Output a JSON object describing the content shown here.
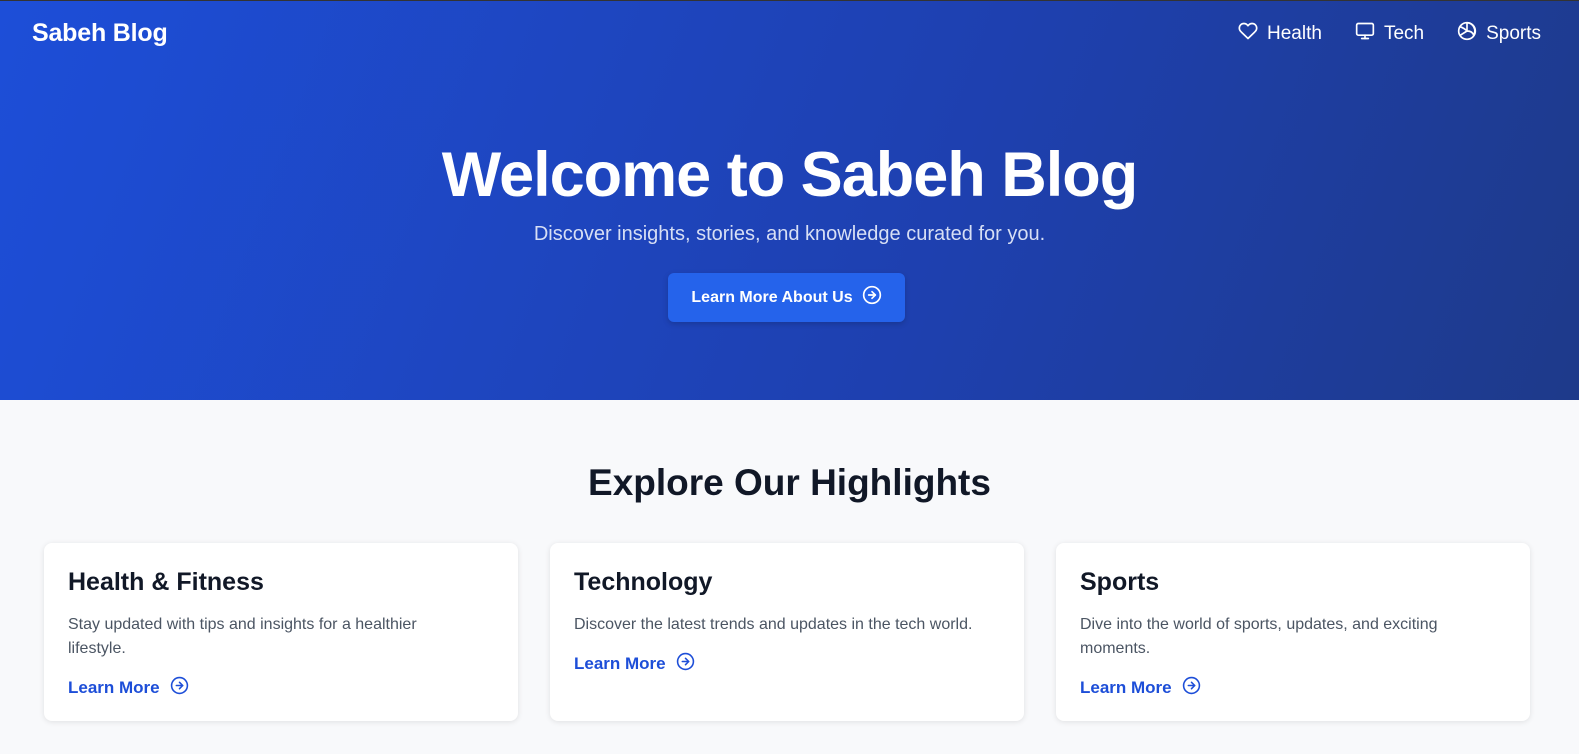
{
  "header": {
    "brand": "Sabeh Blog",
    "nav": [
      {
        "label": "Health",
        "icon": "heart-icon"
      },
      {
        "label": "Tech",
        "icon": "monitor-icon"
      },
      {
        "label": "Sports",
        "icon": "volleyball-icon"
      }
    ]
  },
  "hero": {
    "title": "Welcome to Sabeh Blog",
    "subtitle": "Discover insights, stories, and knowledge curated for you.",
    "button_label": "Learn More About Us",
    "button_icon": "arrow-right-circle-icon"
  },
  "highlights": {
    "title": "Explore Our Highlights",
    "cards": [
      {
        "title": "Health & Fitness",
        "text": "Stay updated with tips and insights for a healthier lifestyle.",
        "link": "Learn More"
      },
      {
        "title": "Technology",
        "text": "Discover the latest trends and updates in the tech world.",
        "link": "Learn More"
      },
      {
        "title": "Sports",
        "text": "Dive into the world of sports, updates, and exciting moments.",
        "link": "Learn More"
      }
    ]
  },
  "colors": {
    "hero_gradient_start": "#1d4ed8",
    "hero_gradient_end": "#1e3a8a",
    "accent": "#2563eb",
    "link": "#1d4ed8",
    "heading": "#111827",
    "body_text": "#4b5563",
    "page_bg": "#f8f9fb"
  }
}
